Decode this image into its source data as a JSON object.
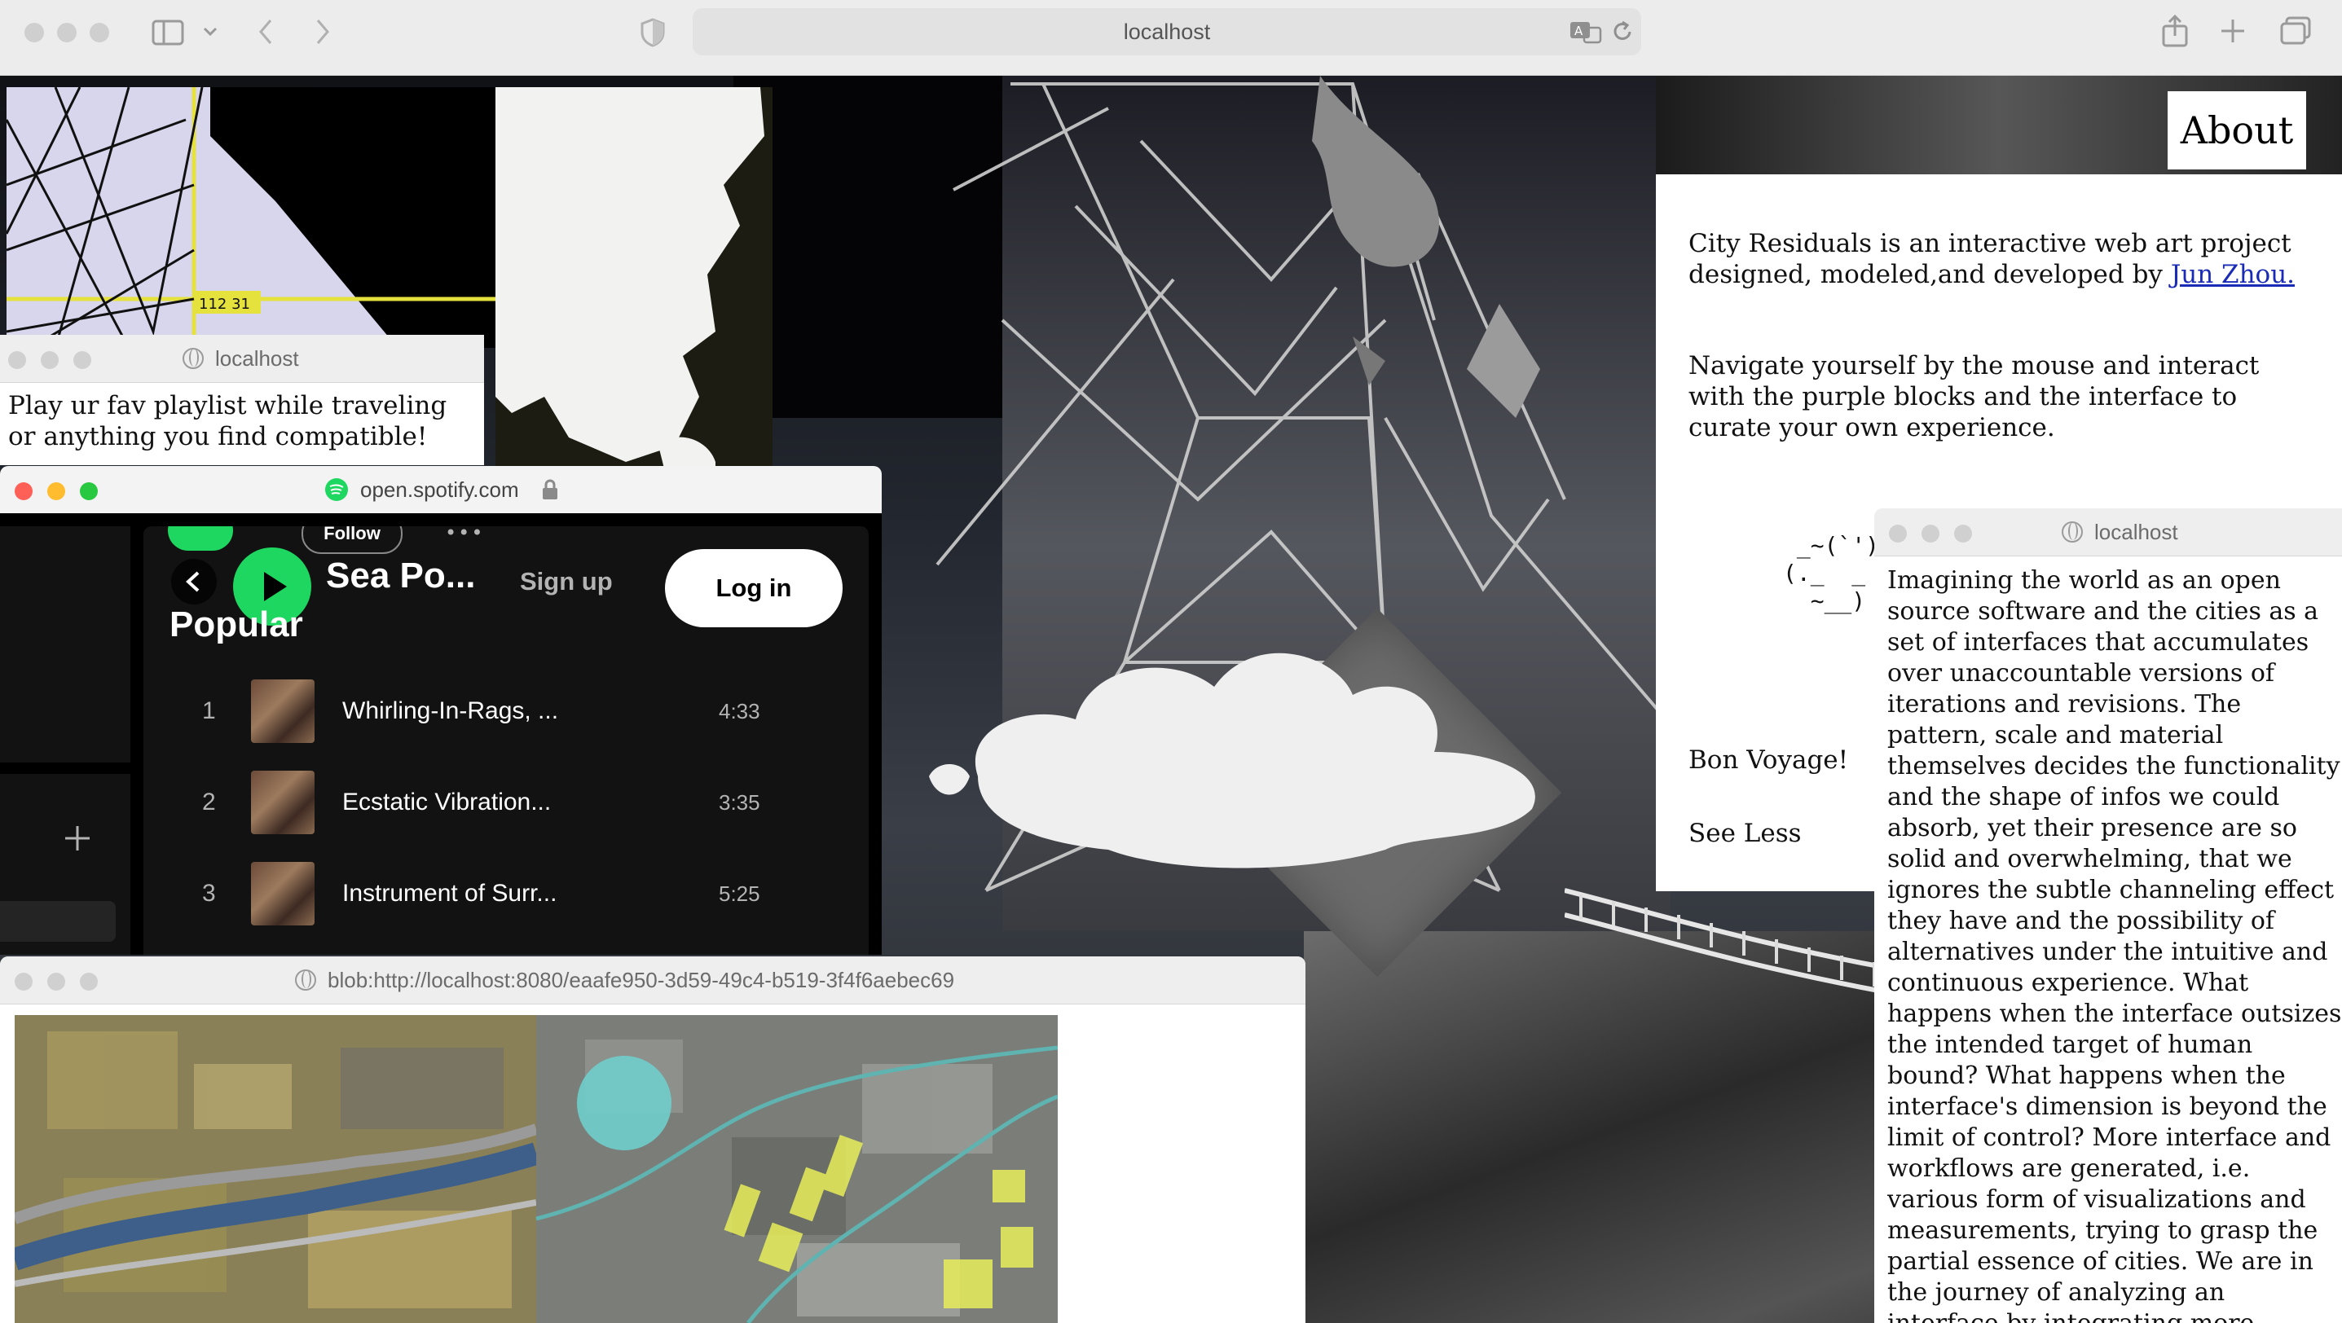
{
  "browser": {
    "url": "localhost"
  },
  "about": {
    "button_label": "About",
    "intro_text": "City Residuals is an interactive web art project designed, modeled,and developed by",
    "author_link": "Jun Zhou.",
    "navigate_text": "Navigate yourself by the mouse and interact with the purple blocks and the interface to curate your own experience.",
    "ascii_art": [
      " _~(`')_",
      "(._  _",
      "  ~__)"
    ],
    "farewell": "Bon Voyage!",
    "see_less": "See Less"
  },
  "playlist_window": {
    "title": "localhost",
    "text": "Play ur fav playlist while traveling or anything you find compatible!"
  },
  "spotify_window": {
    "title": "open.spotify.com",
    "follow_label": "Follow",
    "more_label": "•••",
    "artist_name": "Sea Po...",
    "signup_label": "Sign up",
    "login_label": "Log in",
    "section_title": "Popular",
    "tracks": [
      {
        "num": "1",
        "title": "Whirling-In-Rags, ...",
        "duration": "4:33"
      },
      {
        "num": "2",
        "title": "Ecstatic Vibration...",
        "duration": "3:35"
      },
      {
        "num": "3",
        "title": "Instrument of Surr...",
        "duration": "5:25"
      }
    ],
    "accent_color": "#1ed760"
  },
  "map_window": {
    "title": "blob:http://localhost:8080/eaafe950-3d59-49c4-b519-3f4f6aebec69",
    "highlight_color": "#e8ee5a",
    "circle_color": "#6fd2d0"
  },
  "essay_window": {
    "title": "localhost",
    "text": "Imagining the world as an open source software and the cities as a set of interfaces that accumulates over unaccountable versions of iterations and revisions. The pattern, scale and material themselves decides the functionality and the shape of infos we could absorb, yet their presence are so solid and overwhelming, that we ignores the subtle channeling effect they have and the possibility of alternatives under the intuitive and continuous experience. What happens when the interface outsizes the intended target of human bound? What happens when the interface's dimension is beyond the limit of control? More interface and workflows are generated, i.e. various form of visualizations and measurements, trying to grasp the partial essence of cities. We are in the journey of analyzing an interface by integrating more interfaces in the mind map."
  },
  "scene": {
    "sign_label": "112 31"
  }
}
